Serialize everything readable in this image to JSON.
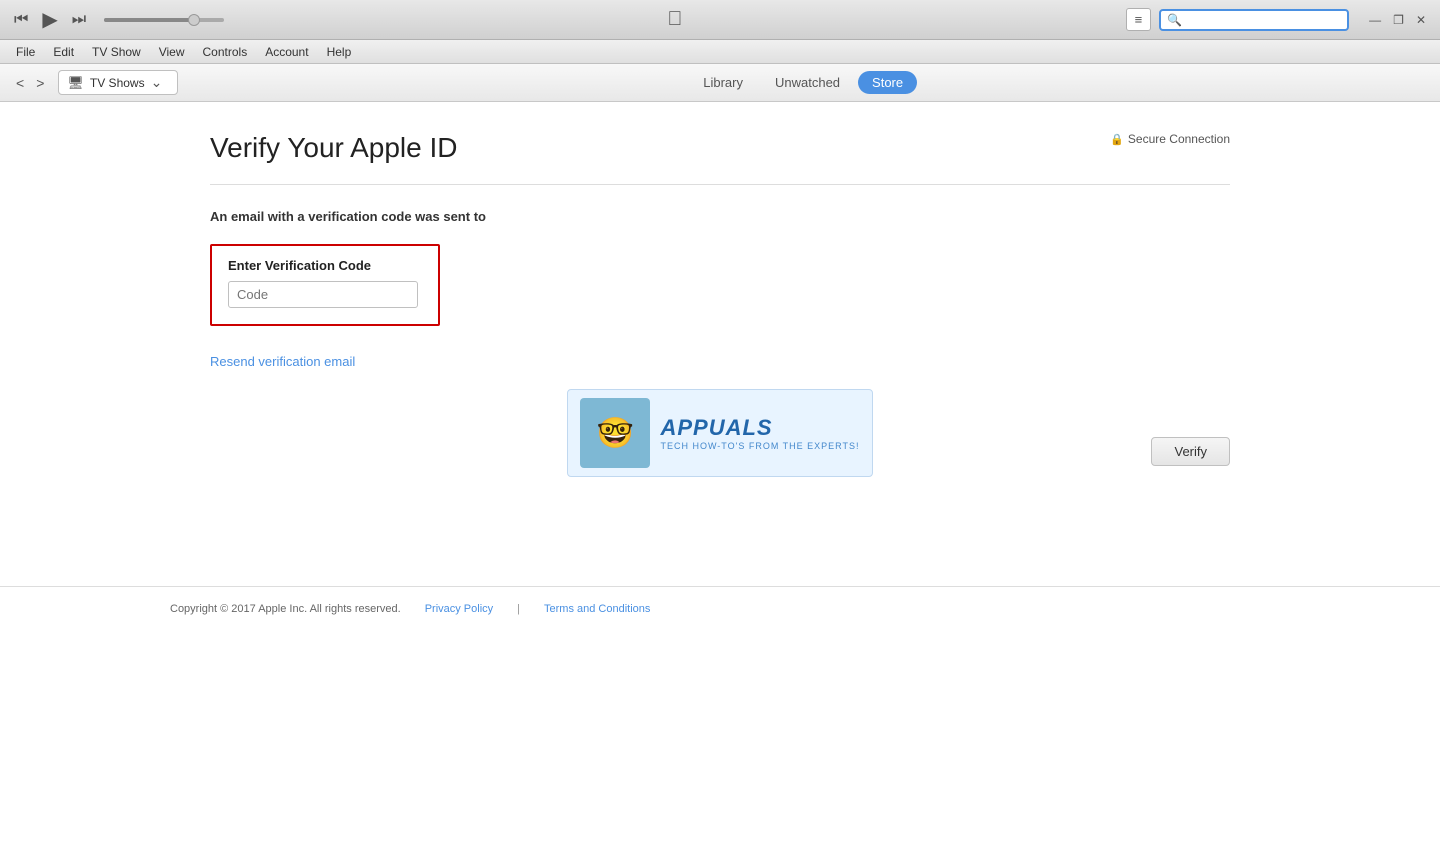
{
  "titlebar": {
    "prev_label": "⏮",
    "play_label": "▶",
    "next_label": "⏭",
    "menu_label": "≡",
    "search_placeholder": "",
    "win_minimize": "—",
    "win_restore": "❐",
    "win_close": "✕"
  },
  "menubar": {
    "items": [
      "File",
      "Edit",
      "TV Show",
      "View",
      "Controls",
      "Account",
      "Help"
    ]
  },
  "navbar": {
    "back_label": "<",
    "forward_label": ">",
    "location_text": "TV Shows",
    "tabs": [
      {
        "label": "Library",
        "active": false
      },
      {
        "label": "Unwatched",
        "active": false
      },
      {
        "label": "Store",
        "active": true
      }
    ]
  },
  "page": {
    "title": "Verify Your Apple ID",
    "secure_connection": "Secure Connection",
    "email_notice": "An email with a verification code was sent to",
    "verification_label": "Enter Verification Code",
    "code_placeholder": "Code",
    "resend_link": "Resend verification email",
    "verify_button": "Verify"
  },
  "appuals": {
    "mascot_emoji": "🤓",
    "title": "APPUALS",
    "subtitle": "TECH HOW-TO'S FROM THE EXPERTS!"
  },
  "footer": {
    "copyright": "Copyright © 2017 Apple Inc. All rights reserved.",
    "privacy_policy": "Privacy Policy",
    "separator": "|",
    "terms": "Terms and Conditions"
  }
}
